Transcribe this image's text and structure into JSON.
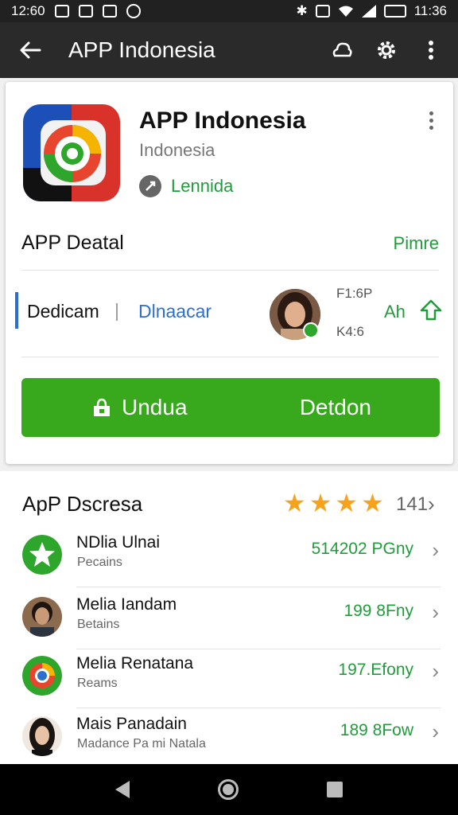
{
  "status_bar": {
    "time_left": "12:60",
    "time_right": "11:36"
  },
  "app_bar": {
    "title": "APP Indonesia"
  },
  "app": {
    "name": "APP Indonesia",
    "subtitle": "Indonesia",
    "developer": "Lennida"
  },
  "detail": {
    "section_title": "APP Deatal",
    "section_link": "Pimre",
    "tab_a": "Dedicam",
    "tab_separator": "|",
    "tab_b": "Dlnaacar",
    "stat_top": "F1:6P",
    "stat_bottom": "K4:6",
    "share_label": "Ah"
  },
  "install_button": {
    "left_label": "Undua",
    "right_label": "Detdon"
  },
  "list": {
    "title": "ApP Dscresa",
    "rating_stars": 4,
    "count": "141",
    "items": [
      {
        "name": "NDlia Ulnai",
        "sub": "Pecains",
        "value": "514202 PGny",
        "icon": "star-icon"
      },
      {
        "name": "Melia Iandam",
        "sub": "Betains",
        "value": "199 8Fny",
        "icon": "person-avatar"
      },
      {
        "name": "Melia Renatana",
        "sub": "Reams",
        "value": "197.Efony",
        "icon": "chrome-icon"
      },
      {
        "name": "Mais Panadain",
        "sub": "Madance Pa mi Natala",
        "value": "189 8Fow",
        "icon": "woman-avatar"
      }
    ]
  },
  "colors": {
    "accent_green": "#38a81d",
    "link_green": "#1f9d3a",
    "accent_blue": "#2d6fcf",
    "star": "#f7a21b"
  }
}
